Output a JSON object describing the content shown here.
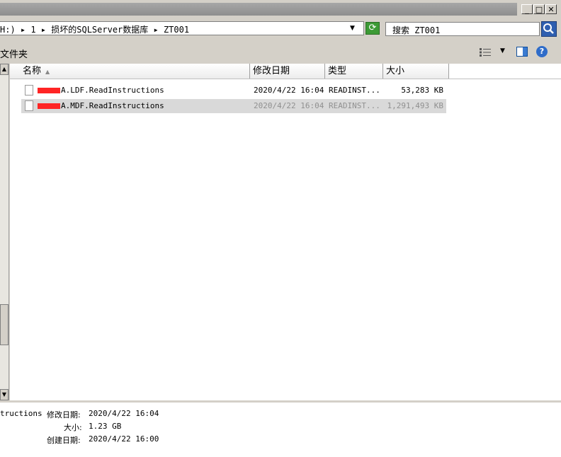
{
  "window": {
    "minimize": "_",
    "maximize": "□",
    "close": "✕"
  },
  "address": {
    "path": "H:) ▸ 1 ▸ 损坏的SQLServer数据库 ▸ ZT001",
    "dropdown": "▼"
  },
  "search": {
    "placeholder": "搜索 ZT001"
  },
  "toolbar": {
    "folder_label": "文件夹"
  },
  "columns": [
    "名称",
    "修改日期",
    "类型",
    "大小"
  ],
  "files": [
    {
      "name": "A.LDF.ReadInstructions",
      "modified": "2020/4/22 16:04",
      "type": "READINST...",
      "size": "53,283 KB",
      "selected": false
    },
    {
      "name": "A.MDF.ReadInstructions",
      "modified": "2020/4/22 16:04",
      "type": "READINST...",
      "size": "1,291,493 KB",
      "selected": true
    }
  ],
  "details": {
    "name_tail": "tructions",
    "modified_label": "修改日期:",
    "modified_value": "2020/4/22 16:04",
    "size_label": "大小:",
    "size_value": "1.23 GB",
    "created_label": "创建日期:",
    "created_value": "2020/4/22 16:00"
  },
  "icons": {
    "refresh": "refresh-icon",
    "search": "search-icon",
    "views": "views-icon",
    "preview_pane": "preview-pane-icon",
    "help": "help-icon",
    "file": "file-icon"
  }
}
